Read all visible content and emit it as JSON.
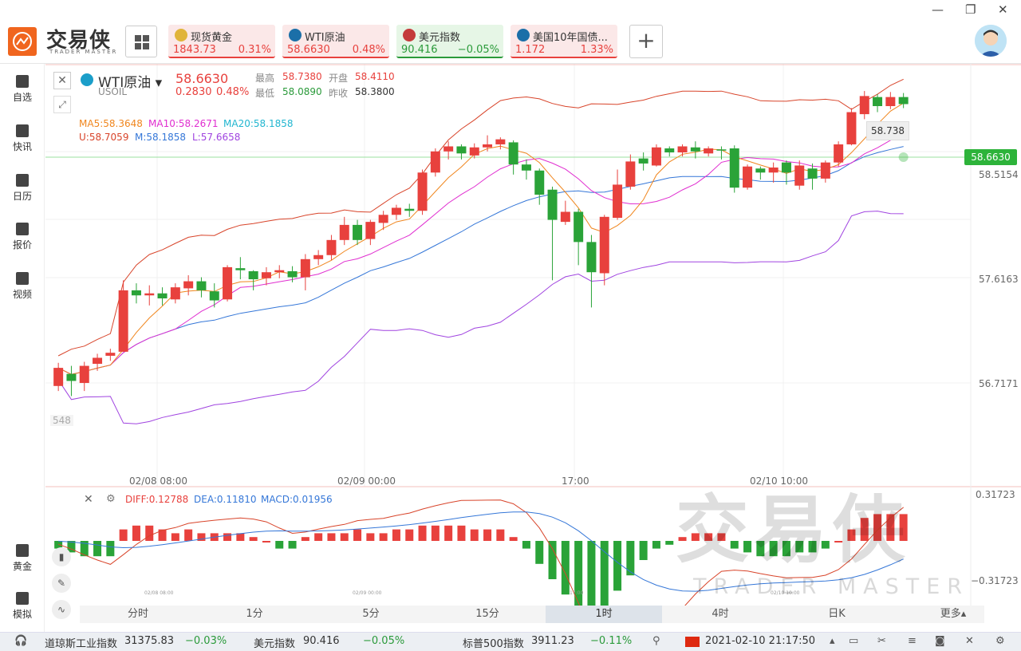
{
  "app": {
    "logo_text": "交易侠",
    "logo_sub": "TRADER MASTER"
  },
  "tickers": [
    {
      "name": "现货黄金",
      "price": "1843.73",
      "change": "0.31%",
      "color": "#e8413d",
      "bg": "#fbe8e8",
      "icon": "gold-icon"
    },
    {
      "name": "WTI原油",
      "price": "58.6630",
      "change": "0.48%",
      "color": "#e8413d",
      "bg": "#fbe8e8",
      "icon": "oil-icon"
    },
    {
      "name": "美元指数",
      "price": "90.416",
      "change": "−0.05%",
      "color": "#2a9a3a",
      "bg": "#e6f6e6",
      "icon": "us-flag-icon"
    },
    {
      "name": "美国10年国债...",
      "price": "1.172",
      "change": "1.33%",
      "color": "#e8413d",
      "bg": "#fbe8e8",
      "icon": "bond-icon"
    }
  ],
  "sidebar": [
    {
      "label": "自选",
      "icon": "add-watch-icon"
    },
    {
      "label": "快讯",
      "icon": "news-icon"
    },
    {
      "label": "日历",
      "icon": "calendar-icon"
    },
    {
      "label": "报价",
      "icon": "quote-icon"
    },
    {
      "label": "视频",
      "icon": "video-icon"
    },
    {
      "label": "黄金",
      "icon": "gold-bar-icon"
    },
    {
      "label": "模拟",
      "icon": "simulate-icon"
    }
  ],
  "header": {
    "name": "WTI原油",
    "code": "USOIL",
    "price": "58.6630",
    "change_abs": "0.2830",
    "change_pct": "0.48%",
    "high_label": "最高",
    "high": "58.7380",
    "open_label": "开盘",
    "open": "58.4110",
    "low_label": "最低",
    "low": "58.0890",
    "prev_label": "昨收",
    "prev": "58.3800"
  },
  "indicators": {
    "ma5": "MA5:58.3648",
    "ma10": "MA10:58.2671",
    "ma20": "MA20:58.1858",
    "bu": "U:58.7059",
    "bm": "M:58.1858",
    "bl": "L:57.6658",
    "macd_diff": "DIFF:0.12788",
    "macd_dea": "DEA:0.11810",
    "macd": "MACD:0.01956"
  },
  "price_axis": {
    "current": "58.6630",
    "ticks": [
      "58.5154",
      "57.6163",
      "56.7171"
    ],
    "tooltip": "58.738",
    "left_ghost": "548"
  },
  "macd_axis": {
    "top": "0.31723",
    "bottom": "−0.31723"
  },
  "time_axis": [
    "02/08 08:00",
    "02/09 00:00",
    "17:00",
    "02/10 10:00"
  ],
  "macd_time_axis": [
    "02/08 08:00",
    "02/09 00:00",
    "17:00",
    "02/10 10:00"
  ],
  "tabs": [
    "分时",
    "1分",
    "5分",
    "15分",
    "1时",
    "4时",
    "日K",
    "更多▴"
  ],
  "active_tab": 4,
  "status": {
    "items": [
      {
        "name": "道琼斯工业指数",
        "value": "31375.83",
        "chg": "−0.03%"
      },
      {
        "name": "美元指数",
        "value": "90.416",
        "chg": "−0.05%"
      },
      {
        "name": "标普500指数",
        "value": "3911.23",
        "chg": "−0.11%"
      }
    ],
    "datetime": "2021-02-10 21:17:50"
  },
  "watermark": {
    "main": "交易侠",
    "sub": "TRADER MASTER"
  },
  "chart_data": {
    "type": "candlestick",
    "candles": [
      [
        56.6,
        56.78,
        56.55,
        56.83
      ],
      [
        56.72,
        56.65,
        56.5,
        56.8
      ],
      [
        56.63,
        56.8,
        56.55,
        56.84
      ],
      [
        56.82,
        56.88,
        56.75,
        56.92
      ],
      [
        56.9,
        56.93,
        56.85,
        56.97
      ],
      [
        56.94,
        57.55,
        56.94,
        57.65
      ],
      [
        57.55,
        57.5,
        57.42,
        57.62
      ],
      [
        57.5,
        57.52,
        57.4,
        57.6
      ],
      [
        57.52,
        57.47,
        57.4,
        57.58
      ],
      [
        57.46,
        57.58,
        57.42,
        57.62
      ],
      [
        57.57,
        57.64,
        57.5,
        57.7
      ],
      [
        57.64,
        57.55,
        57.48,
        57.68
      ],
      [
        57.54,
        57.45,
        57.38,
        57.62
      ],
      [
        57.46,
        57.78,
        57.44,
        57.8
      ],
      [
        57.77,
        57.75,
        57.66,
        57.88
      ],
      [
        57.74,
        57.66,
        57.55,
        57.75
      ],
      [
        57.67,
        57.73,
        57.6,
        57.78
      ],
      [
        57.73,
        57.75,
        57.67,
        57.8
      ],
      [
        57.74,
        57.68,
        57.63,
        57.79
      ],
      [
        57.68,
        57.86,
        57.55,
        57.91
      ],
      [
        57.86,
        57.9,
        57.8,
        57.95
      ],
      [
        57.9,
        58.05,
        57.85,
        58.1
      ],
      [
        58.05,
        58.2,
        58.0,
        58.28
      ],
      [
        58.2,
        58.05,
        58.0,
        58.25
      ],
      [
        58.06,
        58.23,
        58.0,
        58.25
      ],
      [
        58.22,
        58.3,
        58.15,
        58.34
      ],
      [
        58.3,
        58.37,
        58.25,
        58.4
      ],
      [
        58.36,
        58.34,
        58.28,
        58.41
      ],
      [
        58.34,
        58.72,
        58.3,
        58.75
      ],
      [
        58.72,
        58.93,
        58.68,
        58.96
      ],
      [
        58.93,
        58.98,
        58.85,
        59.03
      ],
      [
        58.98,
        58.91,
        58.85,
        59.0
      ],
      [
        58.89,
        58.97,
        58.86,
        59.01
      ],
      [
        58.97,
        59.0,
        58.93,
        59.09
      ],
      [
        59.0,
        59.05,
        58.95,
        59.07
      ],
      [
        59.02,
        58.8,
        58.7,
        59.04
      ],
      [
        58.8,
        58.74,
        58.65,
        58.85
      ],
      [
        58.74,
        58.5,
        58.4,
        58.76
      ],
      [
        58.55,
        58.25,
        57.65,
        58.58
      ],
      [
        58.23,
        58.33,
        58.2,
        58.44
      ],
      [
        58.33,
        58.03,
        57.8,
        58.36
      ],
      [
        58.03,
        57.73,
        57.38,
        58.1
      ],
      [
        57.72,
        58.28,
        57.6,
        58.3
      ],
      [
        58.27,
        58.6,
        58.25,
        58.75
      ],
      [
        58.58,
        58.83,
        58.55,
        58.9
      ],
      [
        58.86,
        58.81,
        58.74,
        58.92
      ],
      [
        58.79,
        58.97,
        58.78,
        59.0
      ],
      [
        58.96,
        58.92,
        58.88,
        58.98
      ],
      [
        58.92,
        58.98,
        58.88,
        59.0
      ],
      [
        58.97,
        58.93,
        58.86,
        59.03
      ],
      [
        58.91,
        58.96,
        58.88,
        58.98
      ],
      [
        58.95,
        58.94,
        58.85,
        58.98
      ],
      [
        58.96,
        58.57,
        58.52,
        58.99
      ],
      [
        58.57,
        58.78,
        58.55,
        58.8
      ],
      [
        58.76,
        58.72,
        58.65,
        58.78
      ],
      [
        58.72,
        58.77,
        58.62,
        58.82
      ],
      [
        58.82,
        58.72,
        58.6,
        58.84
      ],
      [
        58.59,
        58.79,
        58.55,
        58.84
      ],
      [
        58.76,
        58.66,
        58.55,
        58.81
      ],
      [
        58.66,
        58.82,
        58.62,
        58.84
      ],
      [
        58.82,
        59.0,
        58.78,
        59.03
      ],
      [
        59.0,
        59.32,
        58.99,
        59.36
      ],
      [
        59.3,
        59.48,
        59.25,
        59.53
      ],
      [
        59.47,
        59.38,
        59.32,
        59.5
      ],
      [
        59.38,
        59.47,
        59.35,
        59.52
      ],
      [
        59.47,
        59.4,
        59.36,
        59.51
      ]
    ],
    "macd_hist": [
      -0.02,
      -0.03,
      -0.04,
      -0.04,
      -0.04,
      0.03,
      0.04,
      0.04,
      0.03,
      0.02,
      0.03,
      0.02,
      0.02,
      0.02,
      0.02,
      0.01,
      0.0,
      -0.02,
      -0.02,
      0.01,
      0.02,
      0.02,
      0.02,
      0.03,
      0.02,
      0.02,
      0.03,
      0.03,
      0.04,
      0.04,
      0.04,
      0.04,
      0.03,
      0.03,
      0.03,
      0.01,
      -0.02,
      -0.06,
      -0.1,
      -0.14,
      -0.18,
      -0.2,
      -0.17,
      -0.13,
      -0.09,
      -0.05,
      -0.02,
      -0.01,
      0.01,
      0.02,
      0.02,
      0.02,
      -0.02,
      -0.03,
      -0.04,
      -0.04,
      -0.04,
      -0.03,
      -0.03,
      -0.02,
      0.0,
      0.03,
      0.06,
      0.07,
      0.07,
      0.07
    ]
  }
}
